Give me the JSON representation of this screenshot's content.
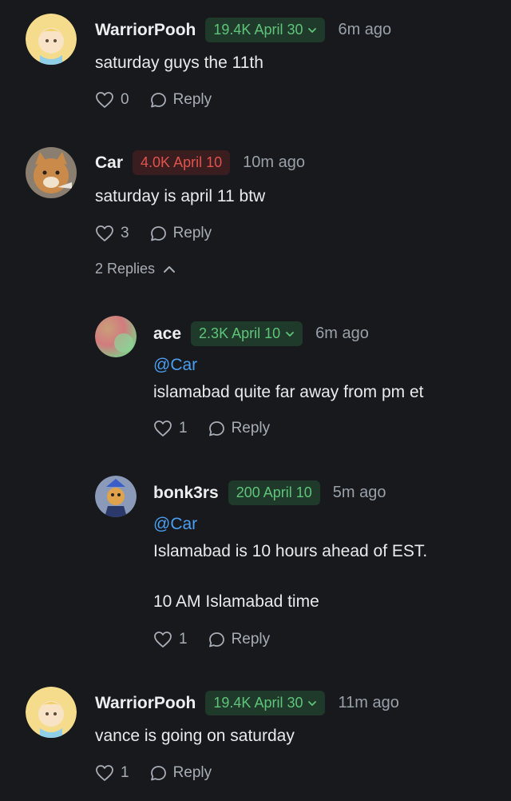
{
  "comments": [
    {
      "username": "WarriorPooh",
      "badge": "19.4K April 30",
      "badge_color": "#5fc47a",
      "time": "6m ago",
      "text": "saturday guys the 11th",
      "likes": "0",
      "reply_label": "Reply"
    },
    {
      "username": "Car",
      "badge": "4.0K April 10",
      "badge_color": "#e0534e",
      "time": "10m ago",
      "text": "saturday is april 11 btw",
      "likes": "3",
      "reply_label": "Reply",
      "replies_toggle": "2 Replies",
      "replies": [
        {
          "username": "ace",
          "badge": "2.3K April 10",
          "badge_color": "#5fc47a",
          "time": "6m ago",
          "mention": "@Car",
          "text": "islamabad quite far away from pm et",
          "likes": "1",
          "reply_label": "Reply"
        },
        {
          "username": "bonk3rs",
          "badge": "200 April 10",
          "badge_color": "#5fc47a",
          "time": "5m ago",
          "mention": "@Car",
          "text": "Islamabad is 10 hours ahead of EST.\n\n10 AM Islamabad time",
          "likes": "1",
          "reply_label": "Reply"
        }
      ]
    },
    {
      "username": "WarriorPooh",
      "badge": "19.4K April 30",
      "badge_color": "#5fc47a",
      "time": "11m ago",
      "text": "vance is going on saturday",
      "likes": "1",
      "reply_label": "Reply"
    }
  ],
  "icons": {
    "like": "heart-outline-icon",
    "reply": "speech-bubble-icon",
    "dropdown": "chevron-down-icon",
    "collapse": "chevron-up-icon"
  }
}
